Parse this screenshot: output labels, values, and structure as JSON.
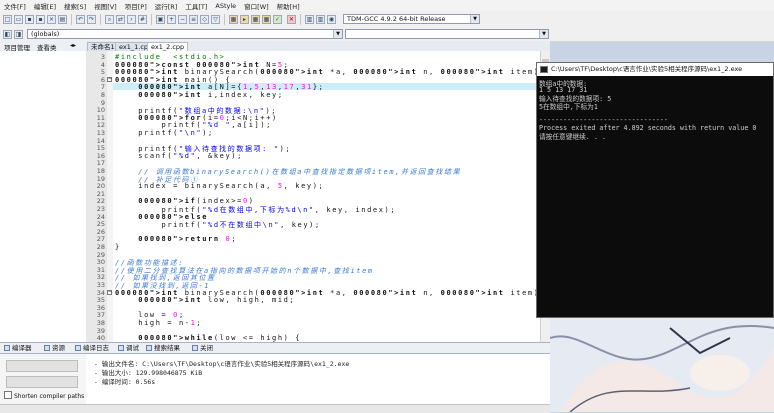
{
  "menu": [
    "文件[F]",
    "编辑[E]",
    "搜索[S]",
    "视图[V]",
    "项目[P]",
    "运行[R]",
    "工具[T]",
    "AStyle",
    "窗口[W]",
    "帮助[H]"
  ],
  "toolbar": {
    "compiler": "TDM-GCC 4.9.2 64-bit Release",
    "scope": "(globals)"
  },
  "left_tabs": [
    "项目管理",
    "查看类"
  ],
  "editor_tabs": [
    "未命名1",
    "ex1_1.cpp",
    "ex1_2.cpp"
  ],
  "code": {
    "lines": [
      {
        "n": "3",
        "t": "#include  <stdio.h>"
      },
      {
        "n": "4",
        "t": "const int N=5;"
      },
      {
        "n": "5",
        "t": "int binarySearch(int *a, int n, int item);"
      },
      {
        "n": "6",
        "t": "int main() {"
      },
      {
        "n": "7",
        "t": "    int a[N]={1,5,13,17,31};"
      },
      {
        "n": "8",
        "t": "    int i,index, key;"
      },
      {
        "n": "9",
        "t": ""
      },
      {
        "n": "10",
        "t": "    printf(\"数组a中的数据:\\n\");"
      },
      {
        "n": "11",
        "t": "    for(i=0;i<N;i++)"
      },
      {
        "n": "12",
        "t": "        printf(\"%d \",a[i]);"
      },
      {
        "n": "13",
        "t": "    printf(\"\\n\");"
      },
      {
        "n": "14",
        "t": ""
      },
      {
        "n": "15",
        "t": "    printf(\"输入待查找的数据项: \");"
      },
      {
        "n": "16",
        "t": "    scanf(\"%d\", &key);"
      },
      {
        "n": "17",
        "t": ""
      },
      {
        "n": "18",
        "t": "    // 调用函数binarySearch()在数组a中查找指定数据项item,并返回查找结果"
      },
      {
        "n": "19",
        "t": "    // 补足代码①"
      },
      {
        "n": "20",
        "t": "    index = binarySearch(a, 5, key);"
      },
      {
        "n": "21",
        "t": ""
      },
      {
        "n": "22",
        "t": "    if(index>=0)"
      },
      {
        "n": "23",
        "t": "        printf(\"%d在数组中,下标为%d\\n\", key, index);"
      },
      {
        "n": "24",
        "t": "    else"
      },
      {
        "n": "25",
        "t": "        printf(\"%d不在数组中\\n\", key);"
      },
      {
        "n": "26",
        "t": ""
      },
      {
        "n": "27",
        "t": "    return 0;"
      },
      {
        "n": "28",
        "t": "}"
      },
      {
        "n": "29",
        "t": ""
      },
      {
        "n": "30",
        "t": "//函数功能描述:"
      },
      {
        "n": "31",
        "t": "//使用二分查找算法在a指向的数据项开始的n个数据中,查找item"
      },
      {
        "n": "32",
        "t": "// 如果找到,返回其位置"
      },
      {
        "n": "33",
        "t": "// 如果没找到,返回-1"
      },
      {
        "n": "34",
        "t": "int binarySearch(int *a, int n, int item) {"
      },
      {
        "n": "35",
        "t": "    int low, high, mid;"
      },
      {
        "n": "36",
        "t": ""
      },
      {
        "n": "37",
        "t": "    low = 0;"
      },
      {
        "n": "38",
        "t": "    high = n-1;"
      },
      {
        "n": "39",
        "t": ""
      },
      {
        "n": "40",
        "t": "    while(low <= high) {"
      }
    ]
  },
  "console": {
    "title": "C:\\Users\\TF\\Desktop\\c语言作业\\实验5相关程序源码\\ex1_2.exe",
    "lines": [
      "数组a中的数据:",
      "1 5 13 17 31",
      "输入待查找的数据项: 5",
      "5在数组中,下标为1",
      "",
      "--------------------------------",
      "Process exited after 4.892 seconds with return value 0",
      "请按任意键继续. . ."
    ]
  },
  "bottom_tabs": [
    "编译器",
    "资源",
    "编译日志",
    "调试",
    "搜索结果",
    "关闭"
  ],
  "compile_log": [
    "- 输出文件名: C:\\Users\\TF\\Desktop\\c语言作业\\实验5相关程序源码\\ex1_2.exe",
    "- 输出大小: 129.998046875 KiB",
    "- 编译时间: 0.56s"
  ],
  "shorten_label": "Shorten compiler paths",
  "colors": {
    "keyword": "#000080",
    "string": "#0000ff",
    "comment": "#3a7bd5",
    "preproc": "#008000",
    "number": "#ff00ff",
    "highlight": "#cdeef8"
  }
}
